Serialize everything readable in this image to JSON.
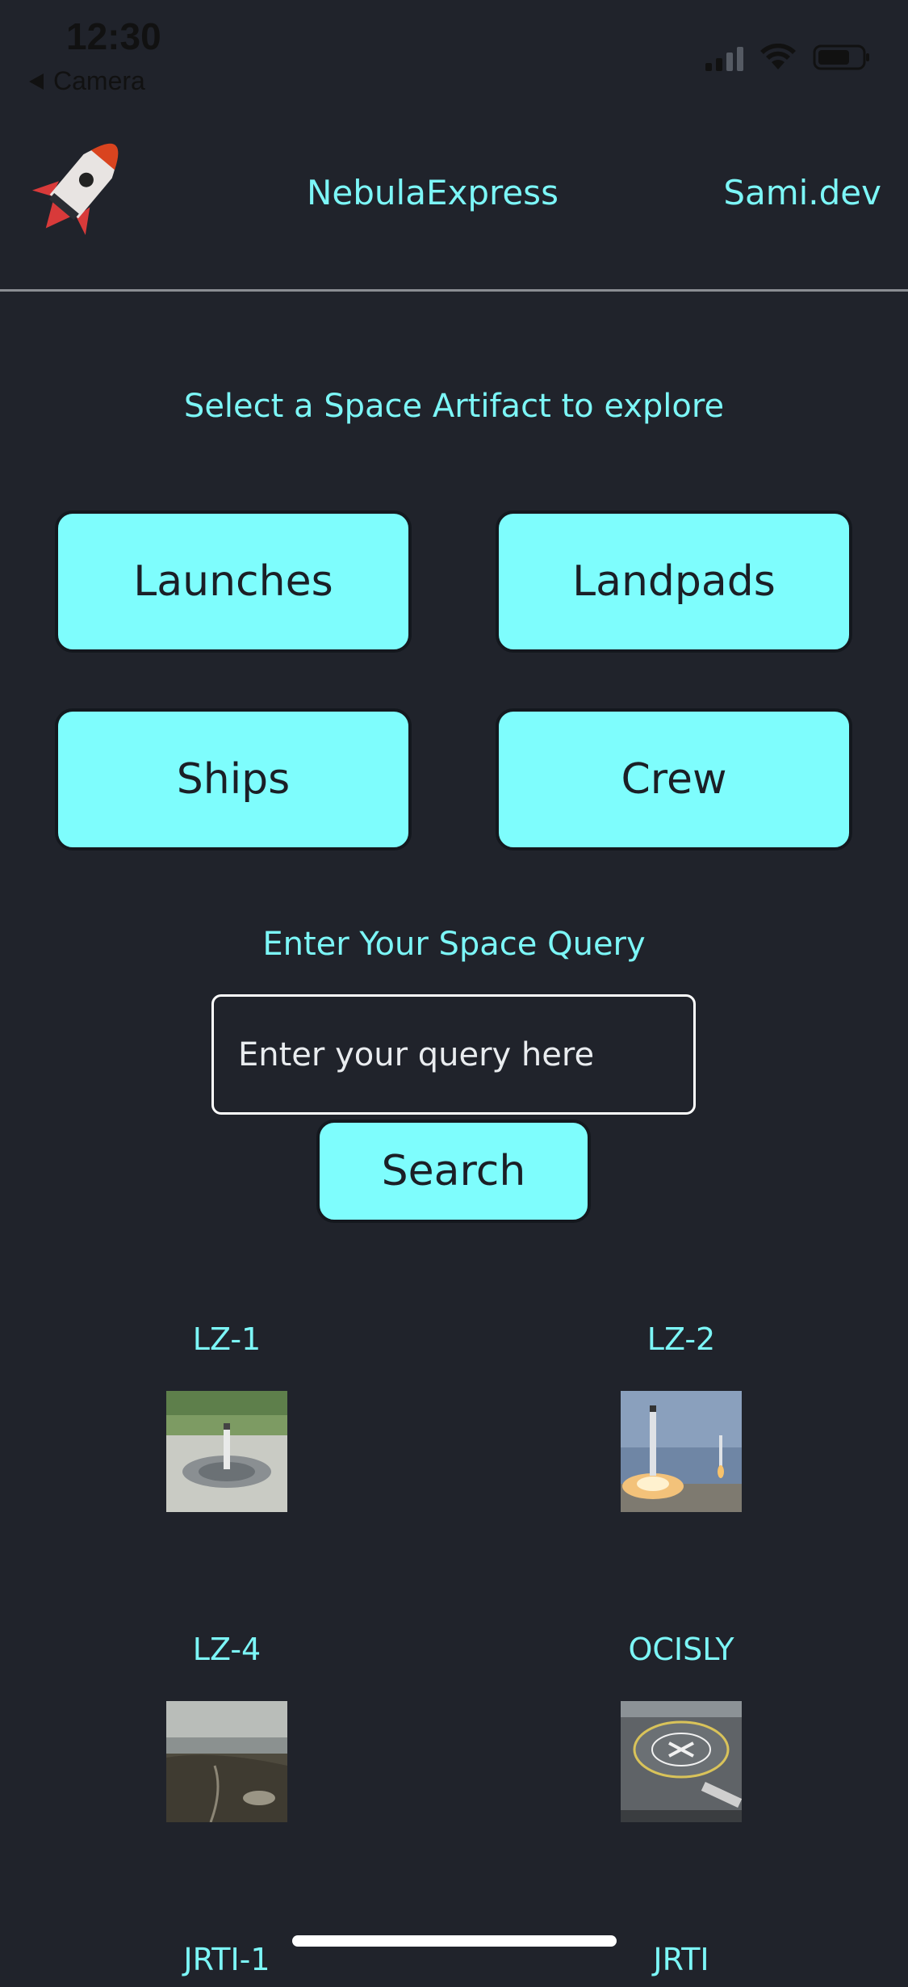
{
  "status_bar": {
    "time": "12:30",
    "back_label": "Camera"
  },
  "header": {
    "brand": "NebulaExpress",
    "site_link": "Sami.dev"
  },
  "prompt": "Select a Space Artifact to explore",
  "categories": [
    {
      "label": "Launches"
    },
    {
      "label": "Landpads"
    },
    {
      "label": "Ships"
    },
    {
      "label": "Crew"
    }
  ],
  "query": {
    "label": "Enter Your Space Query",
    "placeholder": "Enter your query here",
    "value": "",
    "button": "Search"
  },
  "landpads": [
    {
      "name": "LZ-1"
    },
    {
      "name": "LZ-2"
    },
    {
      "name": "LZ-4"
    },
    {
      "name": "OCISLY"
    },
    {
      "name": "JRTI-1"
    },
    {
      "name": "JRTI"
    }
  ],
  "colors": {
    "background": "#20232b",
    "accent": "#7efdfd",
    "accent_text": "#7cf6f7",
    "button_text": "#1b1f26"
  }
}
